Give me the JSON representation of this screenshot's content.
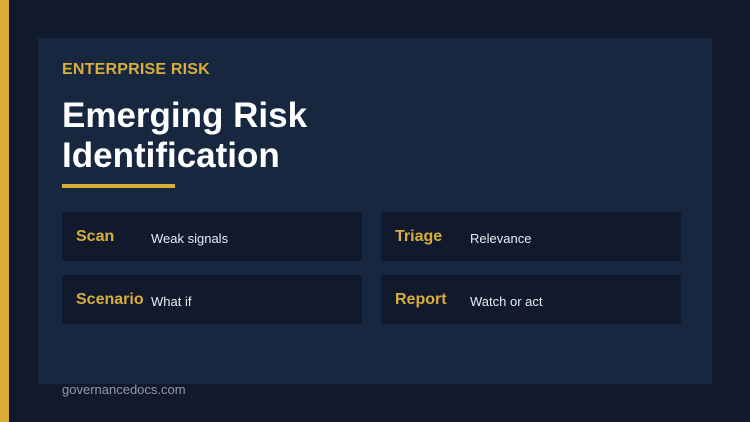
{
  "slide": {
    "eyebrow": "ENTERPRISE RISK",
    "title_line1": "Emerging Risk",
    "title_line2": "Identification",
    "items": [
      {
        "label": "Scan",
        "desc": "Weak signals"
      },
      {
        "label": "Triage",
        "desc": "Relevance"
      },
      {
        "label": "Scenario",
        "desc": "What if"
      },
      {
        "label": "Report",
        "desc": "Watch or act"
      }
    ],
    "footer": "governancedocs.com"
  },
  "colors": {
    "background": "#111a2c",
    "card": "#17273f",
    "accent": "#d8ad3a",
    "title": "#ffffff"
  }
}
